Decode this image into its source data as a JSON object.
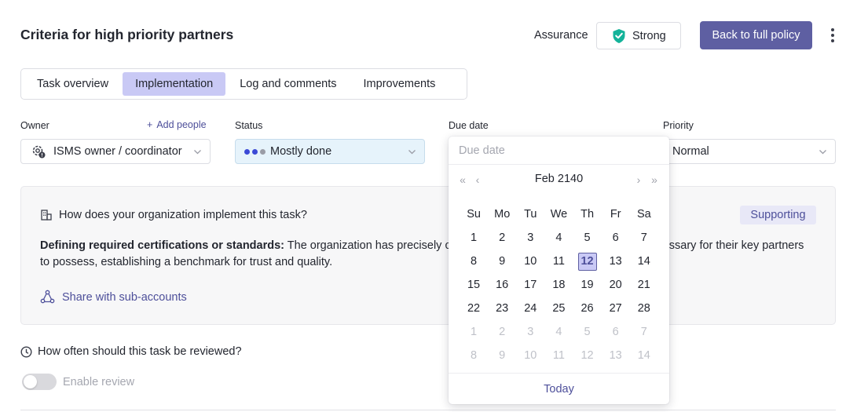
{
  "header": {
    "title": "Criteria for high priority partners",
    "assurance_label": "Assurance",
    "assurance_value": "Strong",
    "back_button": "Back to full policy",
    "more_icon": "kebab-vertical-icon"
  },
  "tabs": [
    {
      "label": "Task overview",
      "active": false
    },
    {
      "label": "Implementation",
      "active": true
    },
    {
      "label": "Log and comments",
      "active": false
    },
    {
      "label": "Improvements",
      "active": false
    }
  ],
  "fields": {
    "owner": {
      "label": "Owner",
      "add_label": "Add people",
      "value": "ISMS owner / coordinator"
    },
    "status": {
      "label": "Status",
      "value": "Mostly done",
      "dot_colors": [
        "#3b49d6",
        "#3b49d6",
        "#9a9ca6"
      ]
    },
    "due_date": {
      "label": "Due date",
      "placeholder": "Due date"
    },
    "priority": {
      "label": "Priority",
      "value": "Normal"
    }
  },
  "implementation": {
    "question": "How does your organization implement this task?",
    "badge": "Supporting",
    "text_bold": "Defining required certifications or standards:",
    "text_visible_start": " The organization has precisely c",
    "text_visible_end": "essary for their key partners",
    "text_line2": "to possess, establishing a benchmark for trust and quality.",
    "share_link": "Share with sub-accounts"
  },
  "review": {
    "question": "How often should this task be reviewed?",
    "toggle_label": "Enable review",
    "enabled": false
  },
  "datepicker": {
    "month_label": "Feb 2140",
    "weekdays": [
      "Su",
      "Mo",
      "Tu",
      "We",
      "Th",
      "Fr",
      "Sa"
    ],
    "weeks": [
      [
        "1",
        "2",
        "3",
        "4",
        "5",
        "6",
        "7"
      ],
      [
        "8",
        "9",
        "10",
        "11",
        "12",
        "13",
        "14"
      ],
      [
        "15",
        "16",
        "17",
        "18",
        "19",
        "20",
        "21"
      ],
      [
        "22",
        "23",
        "24",
        "25",
        "26",
        "27",
        "28"
      ],
      [
        "1",
        "2",
        "3",
        "4",
        "5",
        "6",
        "7"
      ],
      [
        "8",
        "9",
        "10",
        "11",
        "12",
        "13",
        "14"
      ]
    ],
    "muted_from_week": 4,
    "selected": {
      "week": 1,
      "day": 4
    },
    "today_label": "Today",
    "nav_icons": {
      "prev_year": "double-chevron-left-icon",
      "prev_month": "chevron-left-icon",
      "next_month": "chevron-right-icon",
      "next_year": "double-chevron-right-icon"
    }
  },
  "colors": {
    "accent": "#5e5fa2",
    "link": "#4d4f9a",
    "selected_tab": "#c9c9f5",
    "status_bg": "#e6f3fb",
    "shield_green": "#14b39a"
  }
}
